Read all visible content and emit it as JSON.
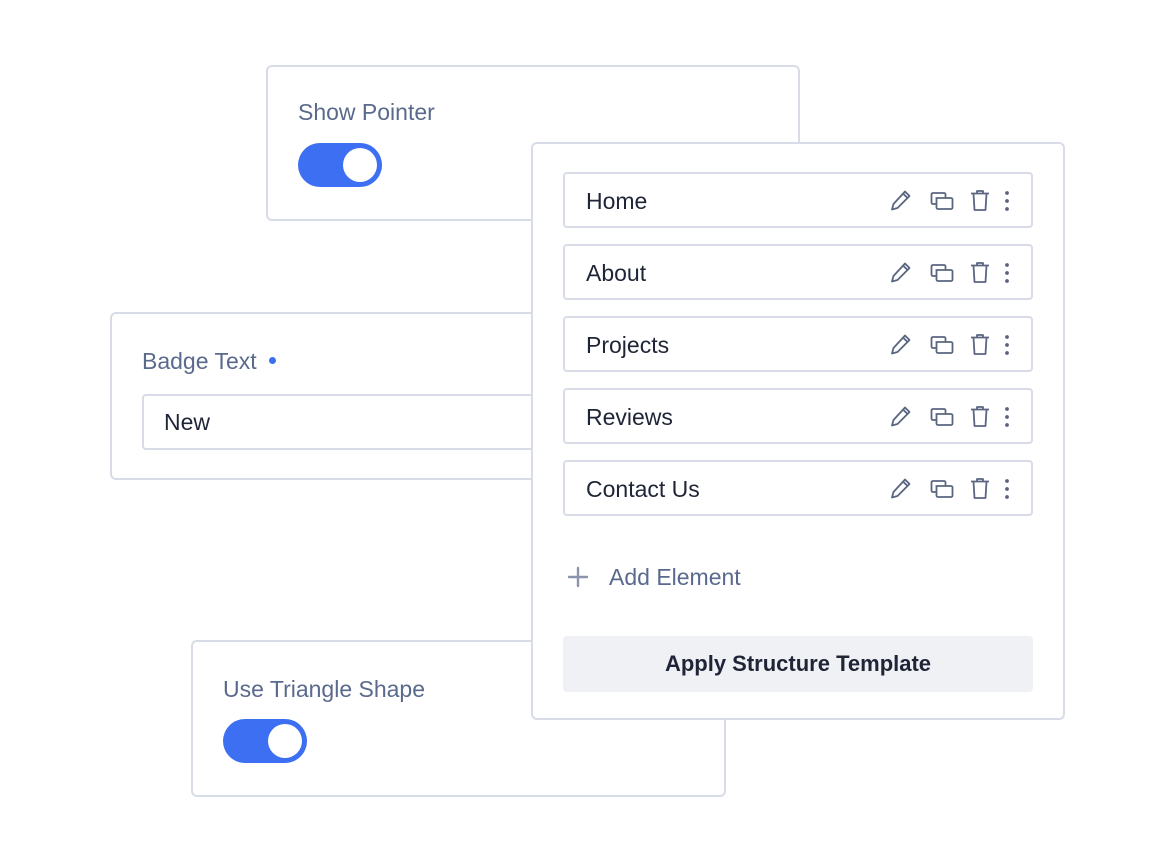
{
  "show_pointer": {
    "label": "Show Pointer",
    "enabled": true
  },
  "badge_text": {
    "label": "Badge Text",
    "value": "New",
    "required": true
  },
  "triangle_shape": {
    "label": "Use Triangle Shape",
    "enabled": true
  },
  "structure": {
    "items": [
      {
        "label": "Home"
      },
      {
        "label": "About"
      },
      {
        "label": "Projects"
      },
      {
        "label": "Reviews"
      },
      {
        "label": "Contact Us"
      }
    ],
    "row_icons": [
      "pencil-icon",
      "copy-icon",
      "trash-icon",
      "more-vertical-icon"
    ],
    "add_label": "Add Element",
    "apply_label": "Apply Structure Template"
  },
  "colors": {
    "accent": "#3d6ff2",
    "border": "#d8dce6",
    "label": "#5a6a8c",
    "text": "#1f2536",
    "button_bg": "#f0f1f5"
  }
}
